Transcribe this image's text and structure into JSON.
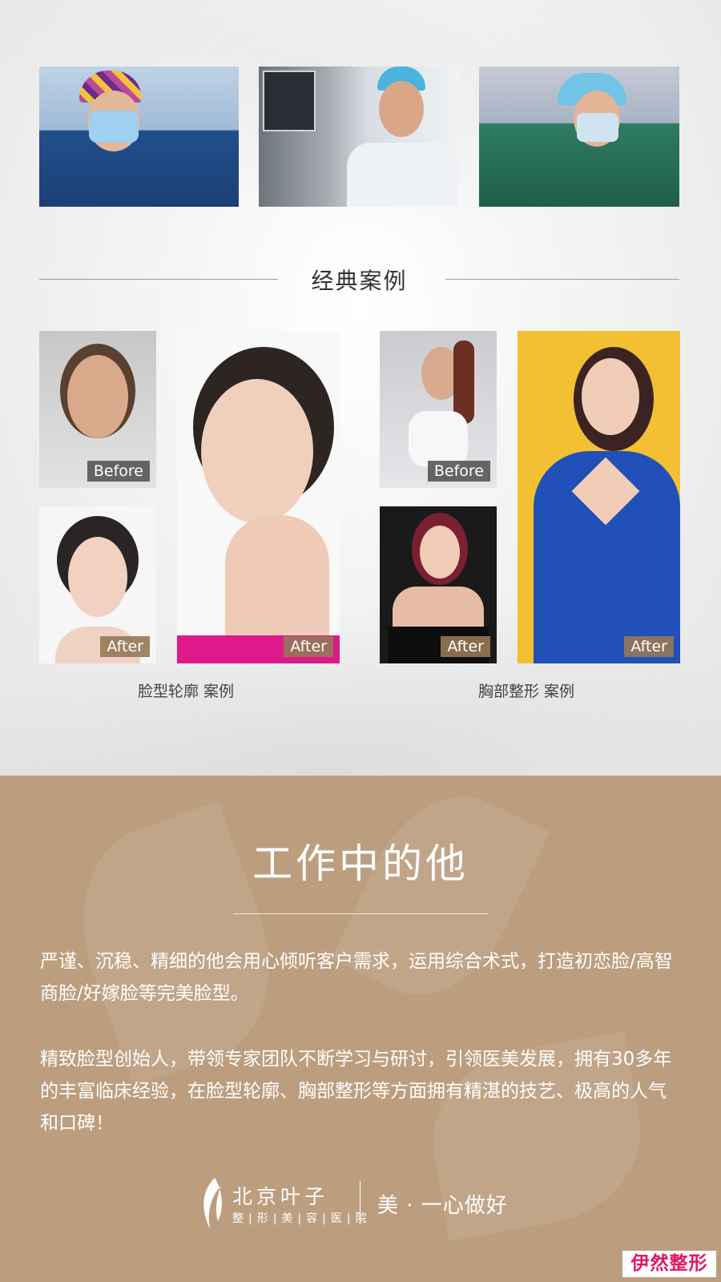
{
  "section_title": "经典案例",
  "before_label": "Before",
  "after_label": "After",
  "case_face": "脸型轮廓  案例",
  "case_breast": "胸部整形  案例",
  "work_title": "工作中的他",
  "para1": "严谨、沉稳、精细的他会用心倾听客户需求，运用综合术式，打造初恋脸/高智商脸/好嫁脸等完美脸型。",
  "para2": "精致脸型创始人，带领专家团队不断学习与研讨，引领医美发展，拥有30多年的丰富临床经验，在脸型轮廓、胸部整形等方面拥有精湛的技艺、极高的人气和口碑！",
  "logo_name": "北京叶子",
  "logo_sub": "整|形|美|容|医|院",
  "slogan": "美 · 一心做好",
  "watermark": "伊然整形",
  "colors": {
    "brown": "#bc9e7e",
    "badge_red": "#e3155c"
  }
}
